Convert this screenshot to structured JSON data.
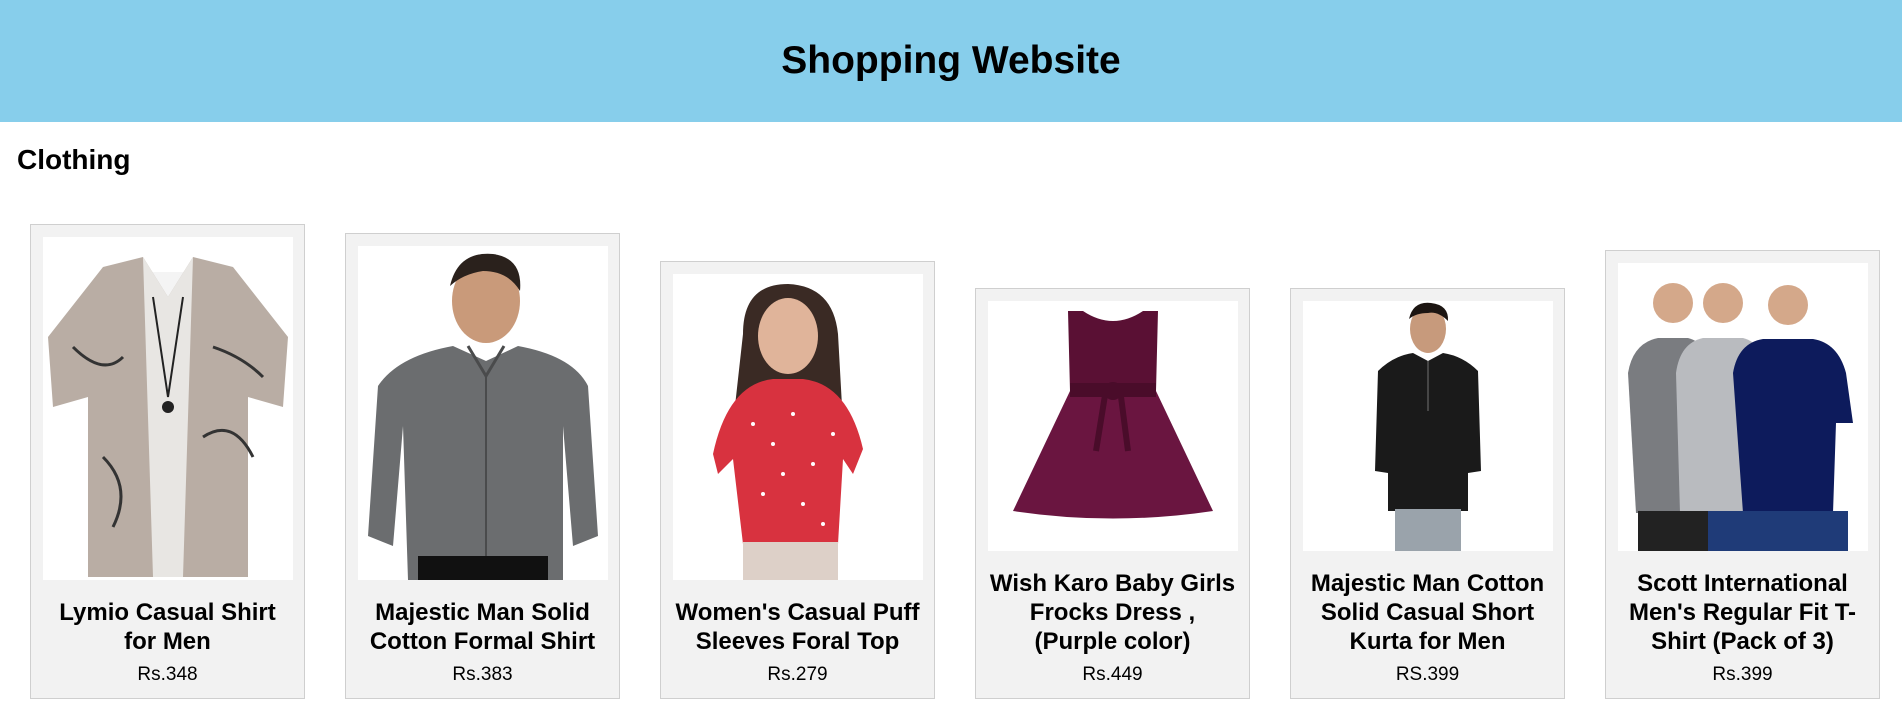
{
  "header": {
    "title": "Shopping Website"
  },
  "section": {
    "title": "Clothing"
  },
  "products": [
    {
      "name": "Lymio Casual Shirt for Men",
      "price": "Rs.348"
    },
    {
      "name": "Majestic Man Solid Cotton Formal Shirt",
      "price": "Rs.383"
    },
    {
      "name": "Women's Casual Puff Sleeves Foral Top",
      "price": "Rs.279"
    },
    {
      "name": "Wish Karo Baby Girls Frocks Dress , (Purple color)",
      "price": "Rs.449"
    },
    {
      "name": "Majestic Man Cotton Solid Casual Short Kurta for Men",
      "price": "RS.399"
    },
    {
      "name": "Scott International Men's Regular Fit T-Shirt (Pack of 3)",
      "price": "Rs.399"
    }
  ]
}
